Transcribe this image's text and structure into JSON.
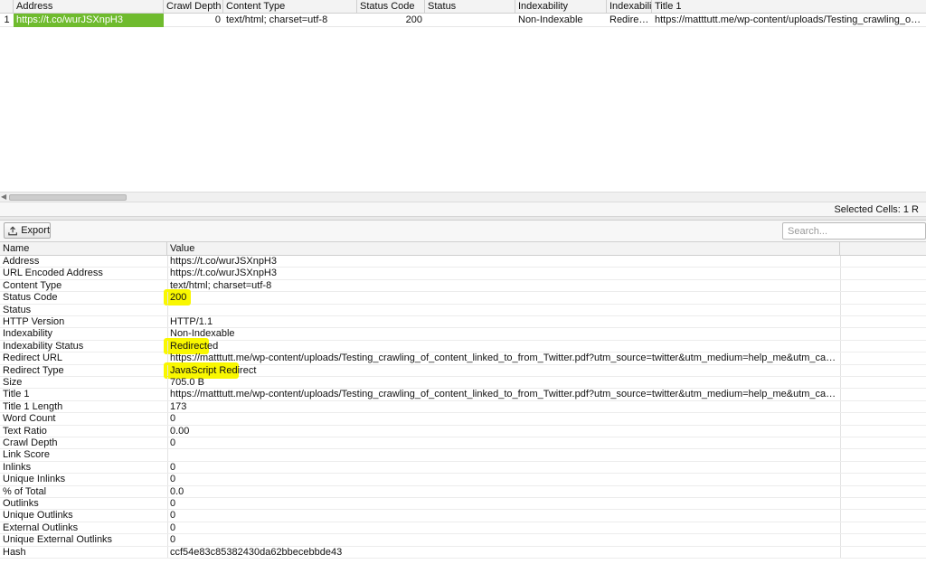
{
  "top_grid": {
    "columns": [
      "Address",
      "Crawl Depth",
      "Content Type",
      "Status Code",
      "Status",
      "Indexability",
      "Indexabili...",
      "Title 1"
    ],
    "row": {
      "index": "1",
      "address": "https://t.co/wurJSXnpH3",
      "crawl_depth": "0",
      "content_type": "text/html; charset=utf-8",
      "status_code": "200",
      "status": "",
      "indexability": "Non-Indexable",
      "indexability_status": "Redirected",
      "title_1": "https://matttutt.me/wp-content/uploads/Testing_crawling_of_content_lin..."
    }
  },
  "status_bar": {
    "selected_cells": "Selected Cells:  1  R"
  },
  "toolbar": {
    "export_label": "Export",
    "search_placeholder": "Search..."
  },
  "details": {
    "header_name": "Name",
    "header_value": "Value",
    "rows": [
      {
        "name": "Address",
        "value": "https://t.co/wurJSXnpH3"
      },
      {
        "name": "URL Encoded Address",
        "value": "https://t.co/wurJSXnpH3"
      },
      {
        "name": "Content Type",
        "value": "text/html; charset=utf-8"
      },
      {
        "name": "Status Code",
        "value": "200"
      },
      {
        "name": "Status",
        "value": ""
      },
      {
        "name": "HTTP Version",
        "value": "HTTP/1.1"
      },
      {
        "name": "Indexability",
        "value": "Non-Indexable"
      },
      {
        "name": "Indexability Status",
        "value": "Redirected"
      },
      {
        "name": "Redirect URL",
        "value": "https://matttutt.me/wp-content/uploads/Testing_crawling_of_content_linked_to_from_Twitter.pdf?utm_source=twitter&utm_medium=help_me&utm_campaign=i_have_no_idea_what_im..."
      },
      {
        "name": "Redirect Type",
        "value": "JavaScript Redirect"
      },
      {
        "name": "Size",
        "value": "705.0 B"
      },
      {
        "name": "Title 1",
        "value": "https://matttutt.me/wp-content/uploads/Testing_crawling_of_content_linked_to_from_Twitter.pdf?utm_source=twitter&utm_medium=help_me&utm_campaign=i_have_no_idea_what_im..."
      },
      {
        "name": "Title 1 Length",
        "value": "173"
      },
      {
        "name": "Word Count",
        "value": "0"
      },
      {
        "name": "Text Ratio",
        "value": "0.00"
      },
      {
        "name": "Crawl Depth",
        "value": "0"
      },
      {
        "name": "Link Score",
        "value": ""
      },
      {
        "name": "Inlinks",
        "value": "0"
      },
      {
        "name": "Unique Inlinks",
        "value": "0"
      },
      {
        "name": "% of Total",
        "value": "0.0"
      },
      {
        "name": "Outlinks",
        "value": "0"
      },
      {
        "name": "Unique Outlinks",
        "value": "0"
      },
      {
        "name": "External Outlinks",
        "value": "0"
      },
      {
        "name": "Unique External Outlinks",
        "value": "0"
      },
      {
        "name": "Hash",
        "value": "ccf54e83c85382430da62bbecebbde43"
      }
    ]
  },
  "colors": {
    "address_highlight": "#6fbb2e",
    "annotation_highlight": "#fbf900"
  }
}
